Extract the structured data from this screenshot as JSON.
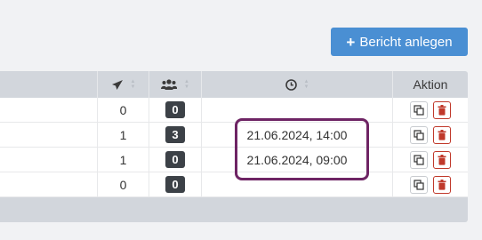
{
  "toolbar": {
    "add_label": "Bericht anlegen"
  },
  "table": {
    "headers": {
      "sent_icon": "send-icon",
      "people_icon": "users-icon",
      "time_icon": "clock-icon",
      "action": "Aktion"
    },
    "rows": [
      {
        "sent": "0",
        "people": "0",
        "time": ""
      },
      {
        "sent": "1",
        "people": "3",
        "time": "21.06.2024, 14:00"
      },
      {
        "sent": "1",
        "people": "0",
        "time": "21.06.2024, 09:00"
      },
      {
        "sent": "0",
        "people": "0",
        "time": ""
      }
    ]
  },
  "colors": {
    "accent": "#4a8fd3",
    "highlight": "#6e2464",
    "delete": "#c0392b"
  }
}
